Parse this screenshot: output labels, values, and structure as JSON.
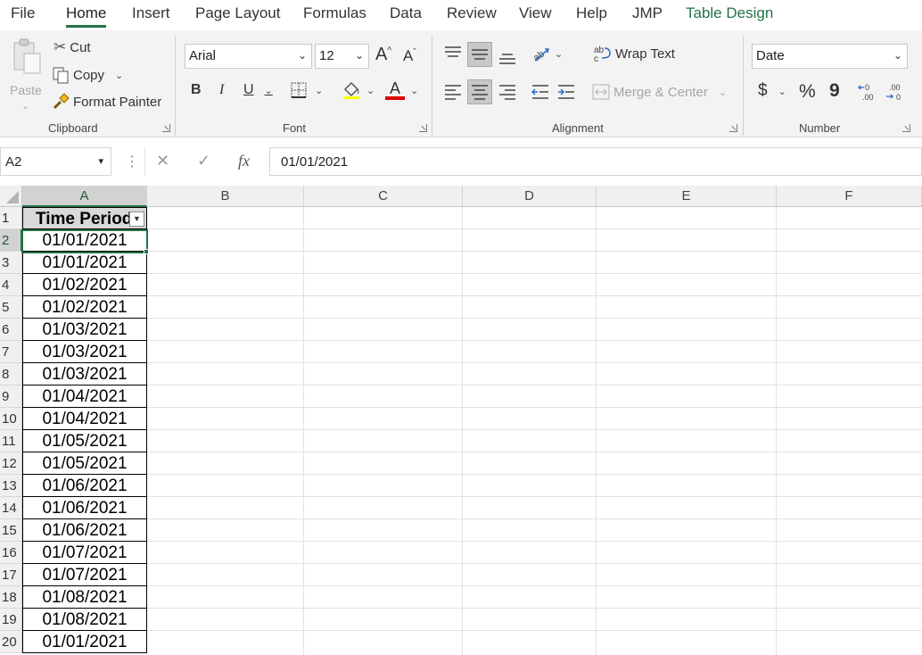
{
  "tabs": [
    {
      "label": "File"
    },
    {
      "label": "Home"
    },
    {
      "label": "Insert"
    },
    {
      "label": "Page Layout"
    },
    {
      "label": "Formulas"
    },
    {
      "label": "Data"
    },
    {
      "label": "Review"
    },
    {
      "label": "View"
    },
    {
      "label": "Help"
    },
    {
      "label": "JMP"
    },
    {
      "label": "Table Design"
    }
  ],
  "active_tab": "Home",
  "ribbon": {
    "clipboard": {
      "paste_label": "Paste",
      "cut_label": "Cut",
      "copy_label": "Copy",
      "format_painter_label": "Format Painter",
      "group_label": "Clipboard"
    },
    "font": {
      "font_name": "Arial",
      "font_size": "12",
      "bold": "B",
      "italic": "I",
      "underline": "U",
      "group_label": "Font",
      "font_color": "#e00000"
    },
    "alignment": {
      "wrap_text_label": "Wrap Text",
      "merge_center_label": "Merge & Center",
      "group_label": "Alignment"
    },
    "number": {
      "format": "Date",
      "currency_symbol": "$",
      "percent_symbol": "%",
      "comma_symbol": "9",
      "group_label": "Number"
    }
  },
  "formula_bar": {
    "name_box": "A2",
    "fx_label": "fx",
    "value": "01/01/2021"
  },
  "columns": [
    "A",
    "B",
    "C",
    "D",
    "E",
    "F"
  ],
  "rows": [
    "1",
    "2",
    "3",
    "4",
    "5",
    "6",
    "7",
    "8",
    "9",
    "10",
    "11",
    "12",
    "13",
    "14",
    "15",
    "16",
    "17",
    "18",
    "19",
    "20"
  ],
  "table": {
    "header": "Time Period",
    "cells": [
      "01/01/2021",
      "01/01/2021",
      "01/02/2021",
      "01/02/2021",
      "01/03/2021",
      "01/03/2021",
      "01/03/2021",
      "01/04/2021",
      "01/04/2021",
      "01/05/2021",
      "01/05/2021",
      "01/06/2021",
      "01/06/2021",
      "01/06/2021",
      "01/07/2021",
      "01/07/2021",
      "01/08/2021",
      "01/08/2021",
      "01/01/2021"
    ]
  },
  "colors": {
    "accent": "#217346",
    "header_fill": "#d9d9d9"
  }
}
